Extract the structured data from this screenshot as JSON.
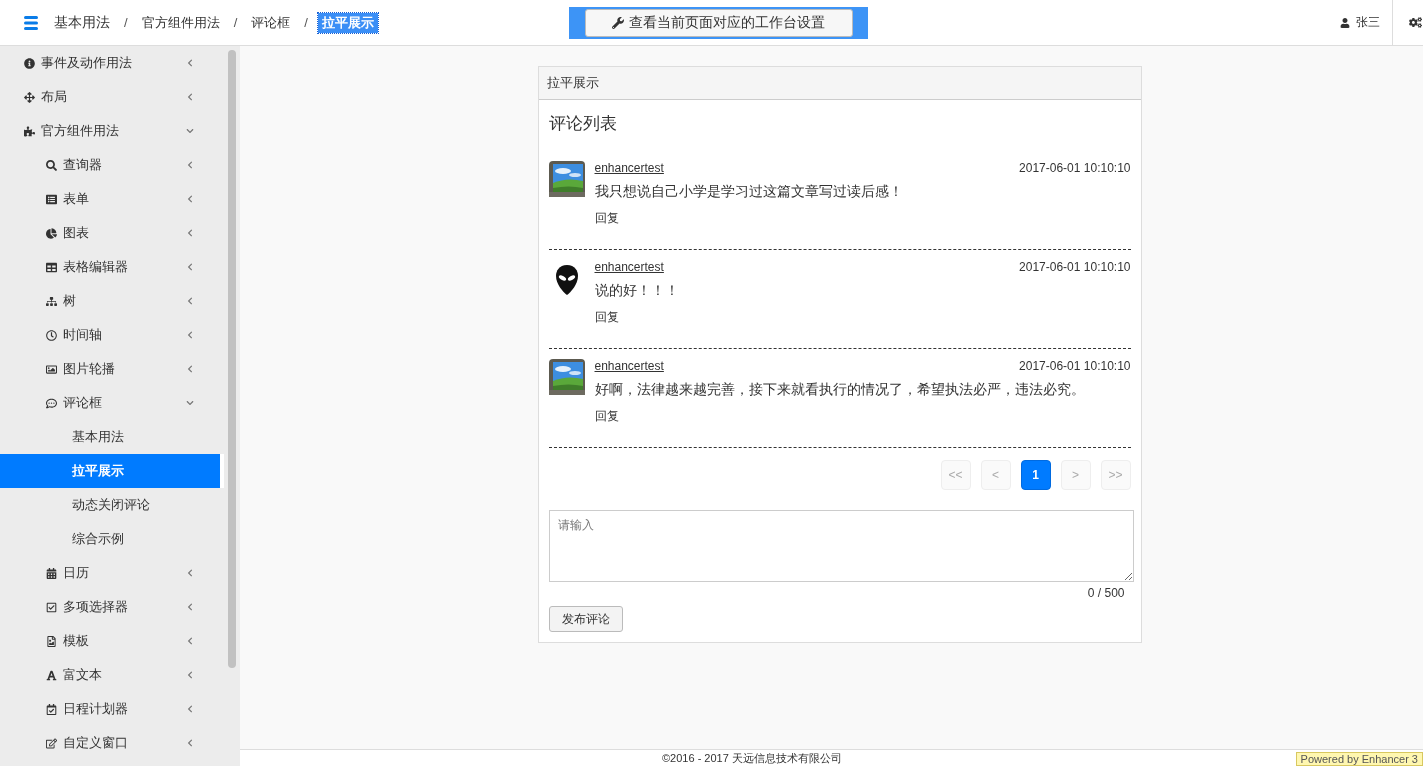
{
  "header": {
    "title": "基本用法",
    "breadcrumbs": [
      {
        "separator": "/",
        "label": "官方组件用法",
        "selected": false
      },
      {
        "separator": "/",
        "label": "评论框",
        "selected": false
      },
      {
        "separator": "/",
        "label": "拉平展示",
        "selected": true
      }
    ],
    "workbench_button": "查看当前页面对应的工作台设置",
    "user": "张三"
  },
  "sidebar": {
    "items": [
      {
        "label": "事件及动作用法",
        "expanded": false,
        "selected": false
      },
      {
        "label": "布局",
        "expanded": false,
        "selected": false
      },
      {
        "label": "官方组件用法",
        "expanded": true,
        "selected": false,
        "children": [
          {
            "label": "查询器",
            "expanded": false,
            "selected": false
          },
          {
            "label": "表单",
            "expanded": false,
            "selected": false
          },
          {
            "label": "图表",
            "expanded": false,
            "selected": false
          },
          {
            "label": "表格编辑器",
            "expanded": false,
            "selected": false
          },
          {
            "label": "树",
            "expanded": false,
            "selected": false
          },
          {
            "label": "时间轴",
            "expanded": false,
            "selected": false
          },
          {
            "label": "图片轮播",
            "expanded": false,
            "selected": false
          },
          {
            "label": "评论框",
            "expanded": true,
            "selected": false,
            "children": [
              {
                "label": "基本用法",
                "selected": false
              },
              {
                "label": "拉平展示",
                "selected": true
              },
              {
                "label": "动态关闭评论",
                "selected": false
              },
              {
                "label": "综合示例",
                "selected": false
              }
            ]
          },
          {
            "label": "日历",
            "expanded": false,
            "selected": false
          },
          {
            "label": "多项选择器",
            "expanded": false,
            "selected": false
          },
          {
            "label": "模板",
            "expanded": false,
            "selected": false
          },
          {
            "label": "富文本",
            "expanded": false,
            "selected": false
          },
          {
            "label": "日程计划器",
            "expanded": false,
            "selected": false
          },
          {
            "label": "自定义窗口",
            "expanded": false,
            "selected": false
          }
        ]
      }
    ]
  },
  "panel": {
    "title": "拉平展示",
    "heading": "评论列表",
    "comments": [
      {
        "user": "enhancertest",
        "time": "2017-06-01 10:10:10",
        "text": "我只想说自己小学是学习过这篇文章写过读后感！",
        "reply": "回复"
      },
      {
        "user": "enhancertest",
        "time": "2017-06-01 10:10:10",
        "text": "说的好！！！",
        "reply": "回复",
        "avatar": {
          "kind": "alien"
        }
      },
      {
        "user": "enhancertest",
        "time": "2017-06-01 10:10:10",
        "text": "好啊，法律越来越完善，接下来就看执行的情况了，希望执法必严，违法必究。",
        "reply": "回复"
      }
    ],
    "pagination": [
      {
        "label": "<<",
        "selected": false,
        "disabled": true
      },
      {
        "label": "<",
        "selected": false,
        "disabled": true
      },
      {
        "label": "1",
        "selected": true,
        "disabled": false
      },
      {
        "label": ">",
        "selected": false,
        "disabled": true
      },
      {
        "label": ">>",
        "selected": false,
        "disabled": true
      }
    ],
    "input": {
      "placeholder": "请输入",
      "counter": "0 / 500"
    },
    "submit": "发布评论"
  },
  "footer": {
    "copyright": "©2016 - 2017 天远信息技术有限公司",
    "badge": "Powered by Enhancer 3"
  }
}
